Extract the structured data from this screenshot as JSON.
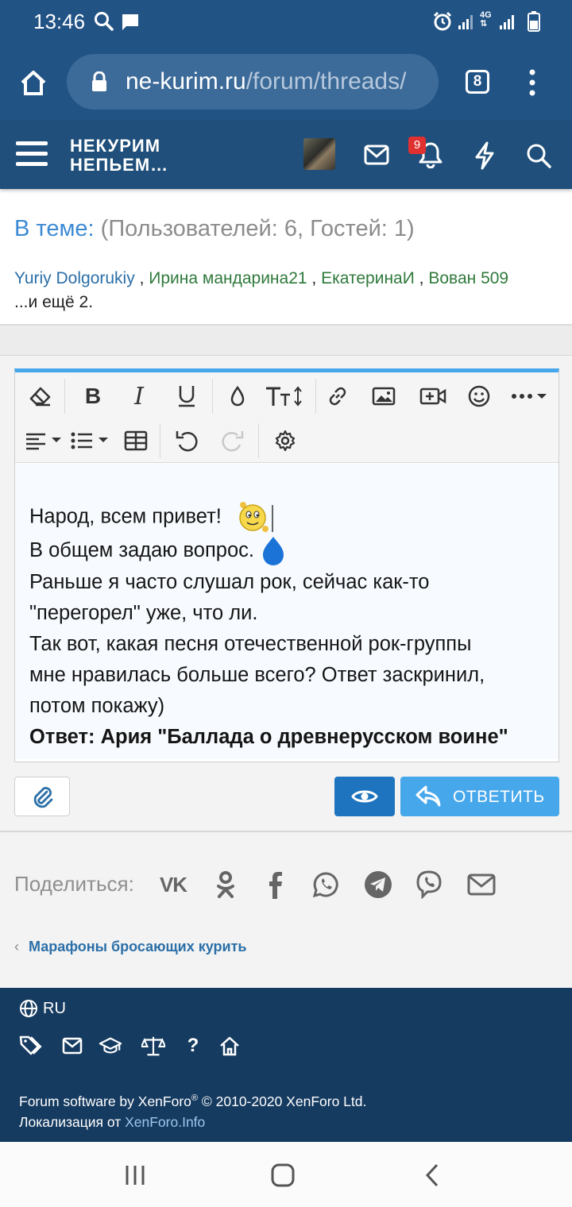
{
  "status_bar": {
    "time": "13:46"
  },
  "browser": {
    "url_domain": "ne-kurim.ru",
    "url_path": "/forum/threads/",
    "tab_count": "8"
  },
  "forum_header": {
    "logo_line1": "НЕКУРИМ",
    "logo_line2": "НЕПЬЕМ…",
    "notification_count": "9"
  },
  "in_topic": {
    "label": "В теме:",
    "stats": "(Пользователей: 6, Гостей: 1)",
    "users": [
      "Yuriy Dolgorukiy",
      "Ирина мандарина21",
      "ЕкатеринаИ",
      "Вован 509"
    ],
    "separator": ",",
    "more": "...и ещё 2."
  },
  "editor": {
    "lines": [
      "Народ, всем привет!",
      "В общем задаю вопрос.",
      "Раньше я часто слушал рок, сейчас как-то",
      "\"перегорел\" уже, что ли.",
      "Так вот, какая песня отечественной рок-группы",
      "мне нравилась больше всего? Ответ заскринил,",
      "потом покажу)"
    ],
    "bold_line": "Ответ: Ария \"Баллада о древнерусском воине\""
  },
  "actions": {
    "reply_label": "ОТВЕТИТЬ"
  },
  "share": {
    "label": "Поделиться:",
    "networks": [
      "vk-icon",
      "odnoklassniki-icon",
      "facebook-icon",
      "whatsapp-icon",
      "telegram-icon",
      "viber-icon",
      "email-icon"
    ]
  },
  "breadcrumb": {
    "label": "Марафоны бросающих курить"
  },
  "footer": {
    "language": "RU",
    "copyright_prefix": "Forum software by XenForo",
    "registered": "®",
    "copyright_suffix": "© 2010-2020 XenForo Ltd.",
    "localization_prefix": "Локализация от",
    "localization_link": "XenForo.Info"
  },
  "colors": {
    "browser_bar": "#215385",
    "forum_header": "#1f4f7a",
    "accent_blue": "#47a7eb",
    "dark_button": "#1e74be",
    "footer": "#163b60",
    "user_link_green": "#2f7a3c"
  }
}
